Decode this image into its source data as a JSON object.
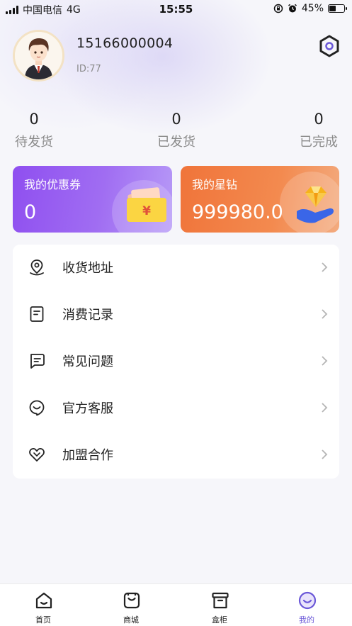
{
  "status_bar": {
    "carrier": "中国电信",
    "network": "4G",
    "time": "15:55",
    "battery": "45%",
    "battery_level": 0.45
  },
  "profile": {
    "phone": "15166000004",
    "id_text": "ID:77"
  },
  "orders": [
    {
      "count": "0",
      "label": "待发货"
    },
    {
      "count": "0",
      "label": "已发货"
    },
    {
      "count": "0",
      "label": "已完成"
    }
  ],
  "cards": {
    "coupon": {
      "title": "我的优惠券",
      "value": "0",
      "symbol": "¥"
    },
    "star": {
      "title": "我的星钻",
      "value": "999980.0"
    }
  },
  "menu": [
    {
      "label": "收货地址",
      "icon": "location-pin-icon"
    },
    {
      "label": "消费记录",
      "icon": "receipt-icon"
    },
    {
      "label": "常见问题",
      "icon": "chat-question-icon"
    },
    {
      "label": "官方客服",
      "icon": "customer-service-icon"
    },
    {
      "label": "加盟合作",
      "icon": "handshake-heart-icon"
    }
  ],
  "tabbar": [
    {
      "label": "首页",
      "icon": "home-icon"
    },
    {
      "label": "商城",
      "icon": "shopping-bag-icon"
    },
    {
      "label": "盒柜",
      "icon": "box-cabinet-icon"
    },
    {
      "label": "我的",
      "icon": "profile-smile-icon",
      "active": true
    }
  ],
  "colors": {
    "coupon_start": "#8f4ff0",
    "star_start": "#f0743a",
    "active_tab": "#6b58d8",
    "settings_ring": "#6b58d8"
  }
}
